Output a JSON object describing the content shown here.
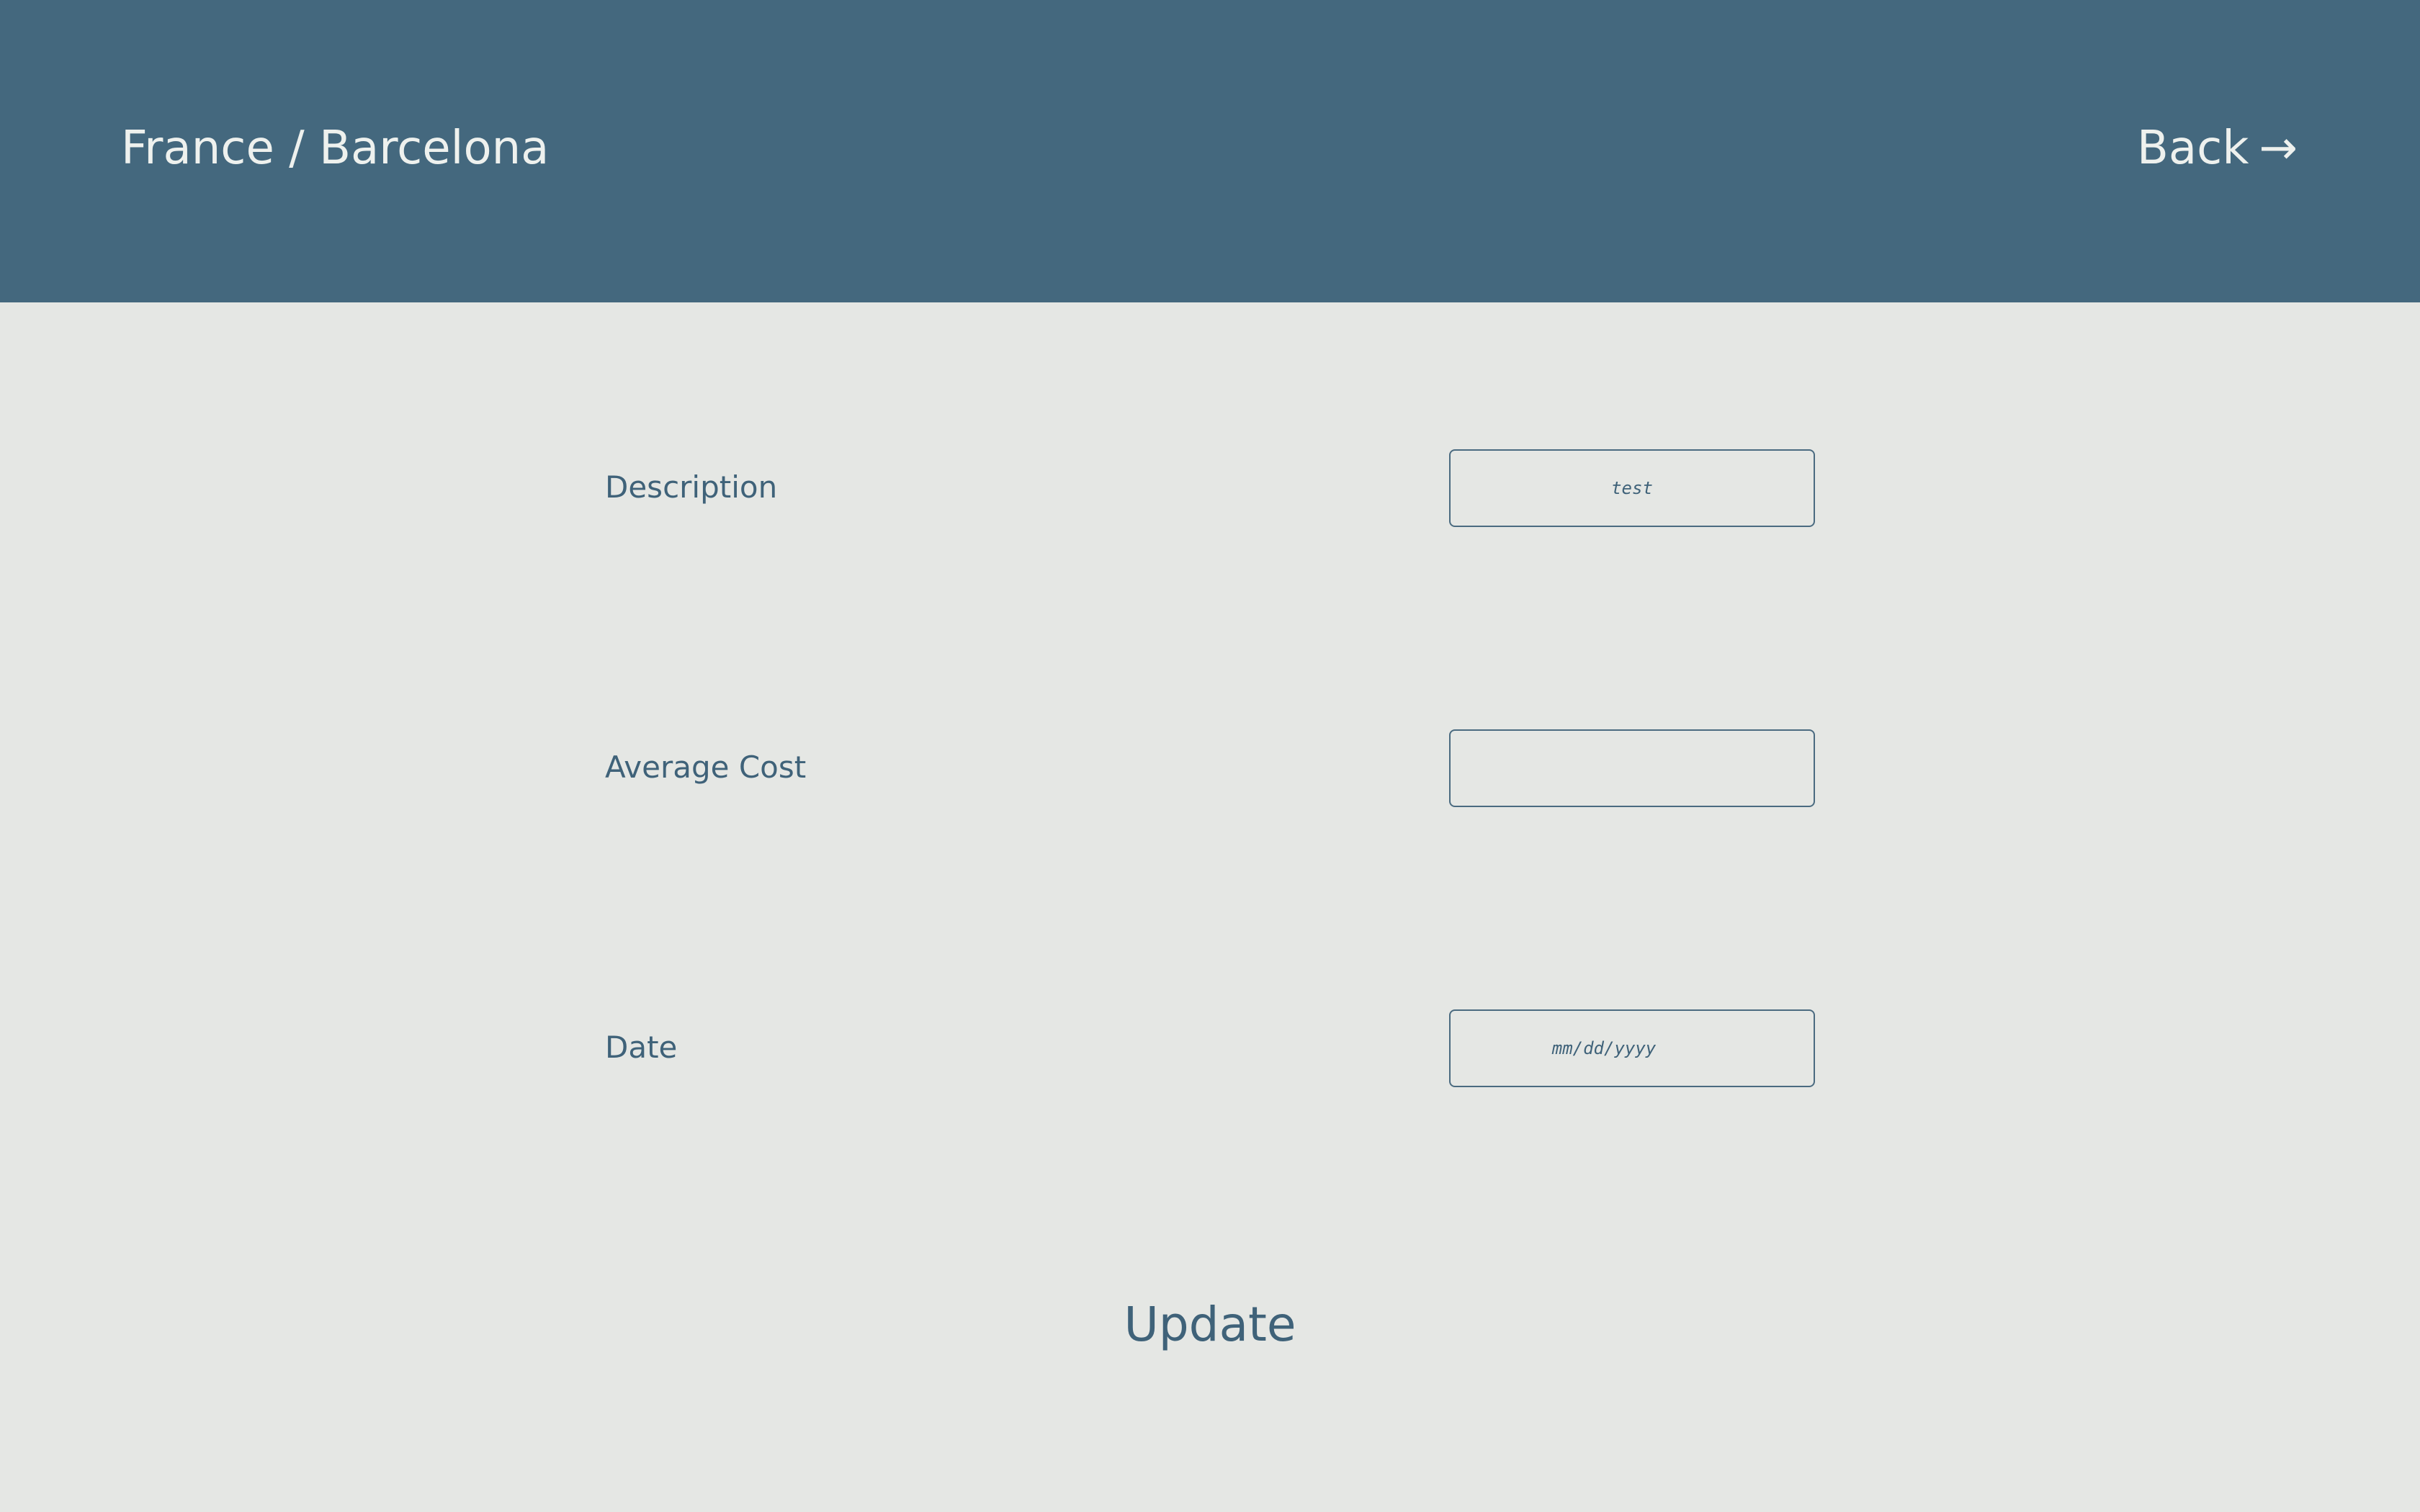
{
  "header": {
    "breadcrumb": "France / Barcelona",
    "back_label": "Back",
    "back_arrow": "→"
  },
  "form": {
    "description": {
      "label": "Description",
      "value": "test",
      "placeholder": ""
    },
    "average_cost": {
      "label": "Average Cost",
      "value": "",
      "placeholder": ""
    },
    "date": {
      "label": "Date",
      "value": "",
      "placeholder": "mm/dd/yyyy"
    },
    "submit_label": "Update"
  },
  "colors": {
    "header_bg": "#44687e",
    "page_bg": "#e5e7e4",
    "text_primary": "#3f6279",
    "header_text": "#eef1ee"
  },
  "icons": {
    "back": "arrow-right-icon"
  }
}
